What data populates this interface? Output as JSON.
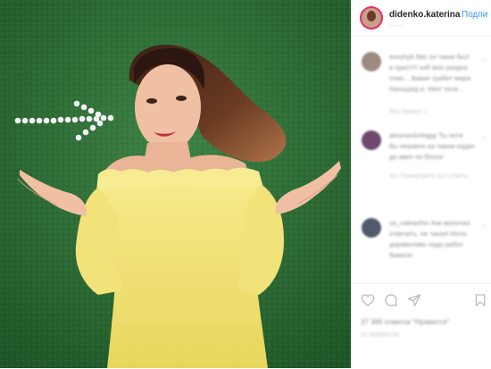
{
  "post": {
    "username": "didenko.katerina",
    "follow_label": "Подпи",
    "location": "........"
  },
  "comments": [
    {
      "avatar_color": "#9b8a82",
      "lines": [
        "eveyhyb Ввс он такик был",
        "в прист!!! изб мне раздни",
        "плах... Вакия трабит мира",
        "Нахоцагд и. Нее! тела..."
      ],
      "meta": "5сн    Орвхпс 1"
    },
    {
      "avatar_color": "#6d4a6d",
      "lines": [
        "aleonardvrloggy Ты хотя",
        "бы неравно на таком кадре",
        "до авел по блога!"
      ],
      "meta": "3сн    Посмотреть все ответы"
    },
    {
      "avatar_color": "#4f5a6a",
      "lines": [
        "sa_nalearthin Как молочка",
        "отвечать, не такая! Инла",
        "доривиливо надо работ",
        "бивигат"
      ],
      "meta": ""
    }
  ],
  "actions": {
    "likes_text": "37 386 отметок \"Нравится\"",
    "date_text": "20 ФЕВРАЛЯ"
  },
  "icons": [
    "heart-icon",
    "comment-icon",
    "share-icon",
    "bookmark-icon"
  ]
}
